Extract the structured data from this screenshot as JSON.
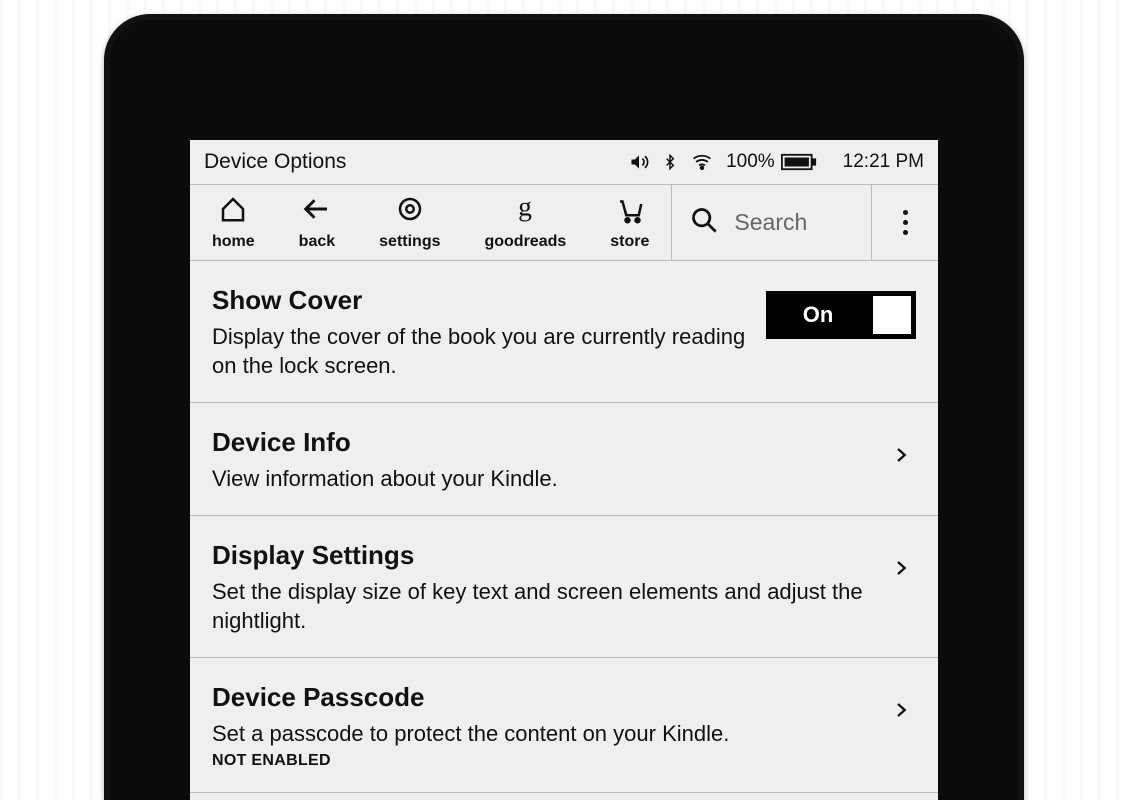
{
  "status": {
    "title": "Device Options",
    "battery_pct": "100%",
    "time": "12:21 PM"
  },
  "toolbar": {
    "home": "home",
    "back": "back",
    "settings": "settings",
    "goodreads": "goodreads",
    "store": "store",
    "search_placeholder": "Search"
  },
  "options": [
    {
      "title": "Show Cover",
      "desc": "Display the cover of the book you are currently reading on the lock screen.",
      "toggle": "On"
    },
    {
      "title": "Device Info",
      "desc": "View information about your Kindle."
    },
    {
      "title": "Display Settings",
      "desc": "Set the display size of key text and screen elements and adjust the nightlight."
    },
    {
      "title": "Device Passcode",
      "desc": "Set a passcode to protect the content on your Kindle.",
      "status": "NOT ENABLED"
    }
  ]
}
